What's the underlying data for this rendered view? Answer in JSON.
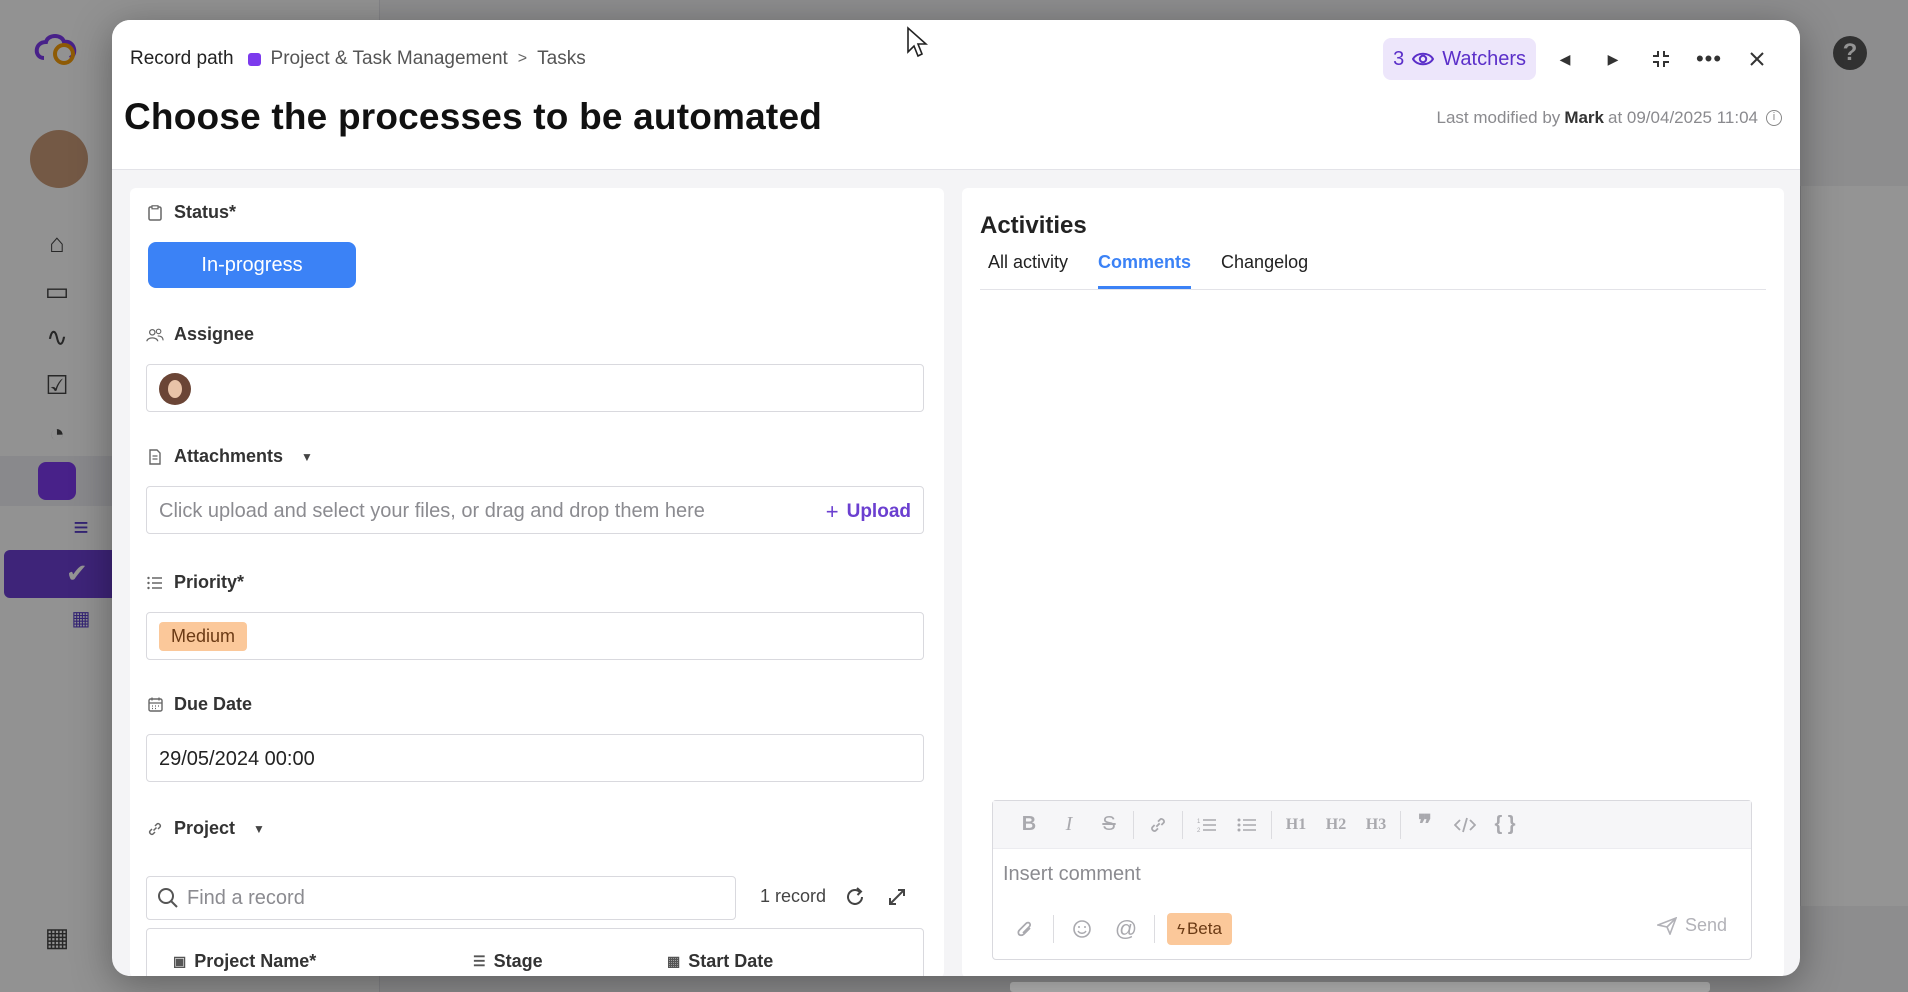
{
  "breadcrumb": {
    "label": "Record path",
    "project": "Project & Task Management",
    "separator": ">",
    "table": "Tasks"
  },
  "record": {
    "title": "Choose the processes to be automated",
    "last_modified_prefix": "Last modified by",
    "last_modified_user": "Mark",
    "last_modified_at": "at 09/04/2025 11:04"
  },
  "watchers": {
    "count": "3",
    "label": "Watchers"
  },
  "fields": {
    "status": {
      "label": "Status*",
      "value": "In-progress",
      "color": "#3b82f6"
    },
    "assignee": {
      "label": "Assignee"
    },
    "attachments": {
      "label": "Attachments",
      "placeholder": "Click upload and select your files, or drag and drop them here",
      "upload_label": "Upload"
    },
    "priority": {
      "label": "Priority*",
      "value": "Medium",
      "color": "#fbc89a"
    },
    "due_date": {
      "label": "Due Date",
      "value": "29/05/2024 00:00"
    },
    "project": {
      "label": "Project",
      "search_placeholder": "Find a record",
      "record_count": "1 record",
      "columns": [
        "Project Name*",
        "Stage",
        "Start Date"
      ]
    }
  },
  "activities": {
    "title": "Activities",
    "tabs": [
      "All activity",
      "Comments",
      "Changelog"
    ],
    "active_tab": "Comments",
    "comment_placeholder": "Insert comment",
    "toolbar": [
      "bold-icon",
      "italic-icon",
      "strikethrough-icon",
      "link-icon",
      "ordered-list-icon",
      "bullet-list-icon",
      "H1",
      "H2",
      "H3",
      "quote-icon",
      "code-icon",
      "code-block-icon"
    ],
    "beta_label": "Beta",
    "send_label": "Send"
  },
  "colors": {
    "accent": "#6b3fd0",
    "watchers_bg": "#ede6fb"
  }
}
